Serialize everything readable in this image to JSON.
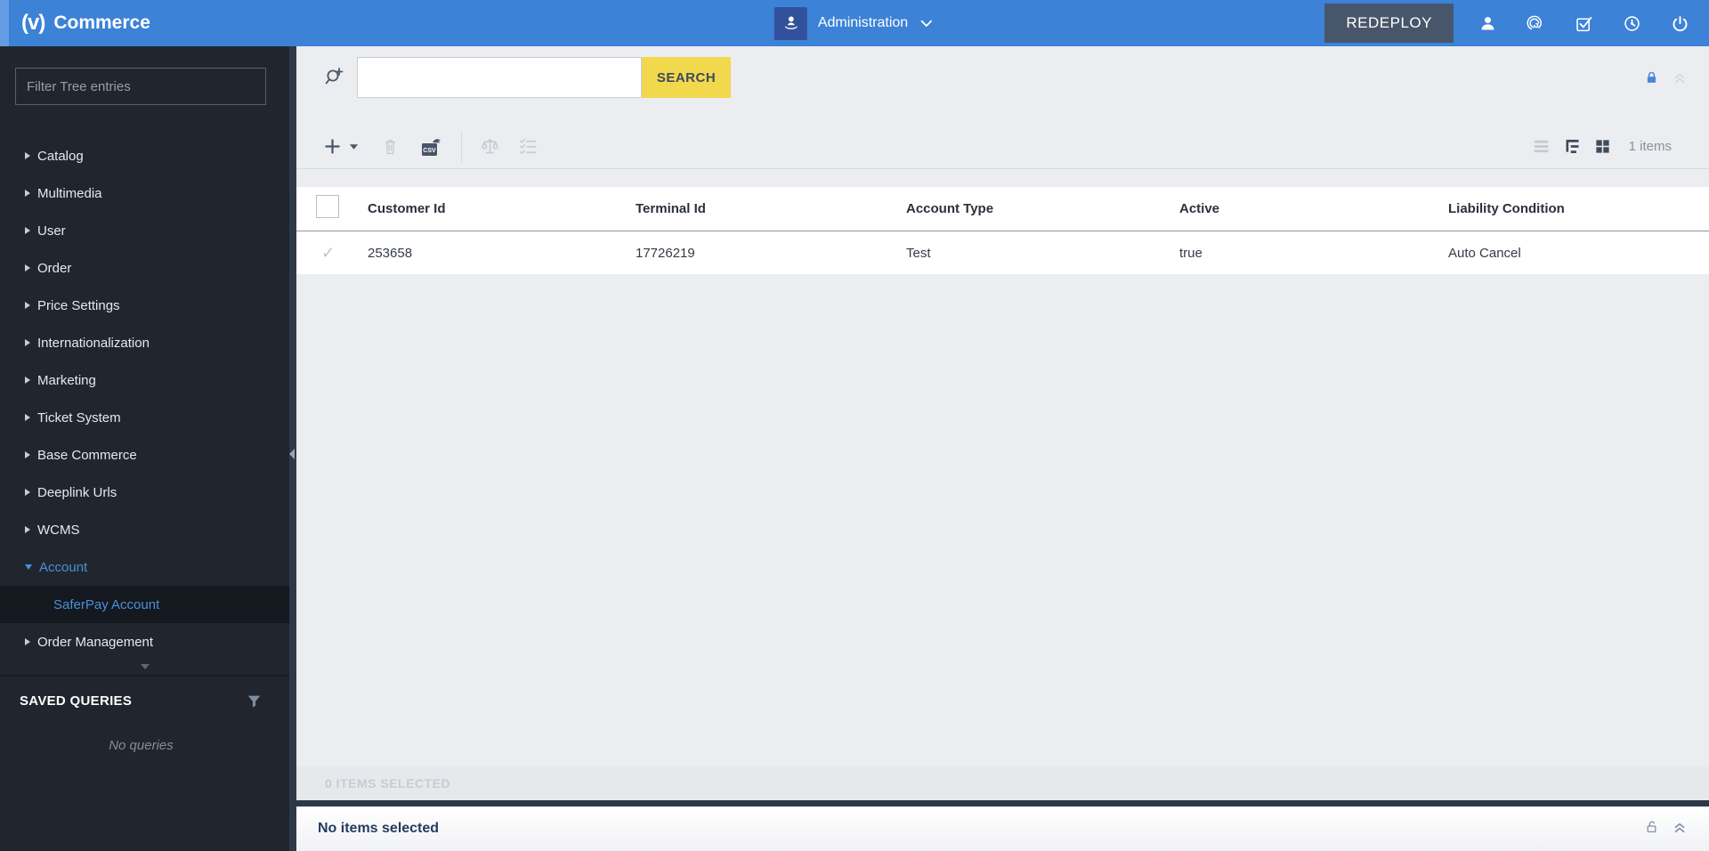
{
  "topbar": {
    "brand_mark": "(v)",
    "brand": "Commerce",
    "context_label": "Administration",
    "redeploy_label": "REDEPLOY"
  },
  "sidebar": {
    "filter_placeholder": "Filter Tree entries",
    "tree": [
      {
        "label": "Catalog",
        "state": "collapsed"
      },
      {
        "label": "Multimedia",
        "state": "collapsed"
      },
      {
        "label": "User",
        "state": "collapsed"
      },
      {
        "label": "Order",
        "state": "collapsed"
      },
      {
        "label": "Price Settings",
        "state": "collapsed"
      },
      {
        "label": "Internationalization",
        "state": "collapsed"
      },
      {
        "label": "Marketing",
        "state": "collapsed"
      },
      {
        "label": "Ticket System",
        "state": "collapsed"
      },
      {
        "label": "Base Commerce",
        "state": "collapsed"
      },
      {
        "label": "Deeplink Urls",
        "state": "collapsed"
      },
      {
        "label": "WCMS",
        "state": "collapsed"
      },
      {
        "label": "Account",
        "state": "expanded",
        "active": true
      },
      {
        "label": "SaferPay Account",
        "state": "child",
        "selected": true
      },
      {
        "label": "Order Management",
        "state": "collapsed"
      }
    ],
    "saved_queries_title": "SAVED QUERIES",
    "saved_queries_empty": "No queries"
  },
  "search": {
    "value": "",
    "button_label": "SEARCH"
  },
  "toolbar": {
    "items_count": "1 items"
  },
  "table": {
    "columns": [
      "Customer Id",
      "Terminal Id",
      "Account Type",
      "Active",
      "Liability Condition"
    ],
    "rows": [
      [
        "253658",
        "17726219",
        "Test",
        "true",
        "Auto Cancel"
      ]
    ]
  },
  "footer": {
    "selected_bar": "0 ITEMS SELECTED",
    "detail_title": "No items selected"
  },
  "colors": {
    "topbar_blue": "#3c82d6",
    "accent_blue": "#4a90d9",
    "search_button_yellow": "#f1d84d",
    "sidebar_bg": "#21262e",
    "redeploy_bg": "#47566b",
    "dark_divider": "#2c3848"
  }
}
